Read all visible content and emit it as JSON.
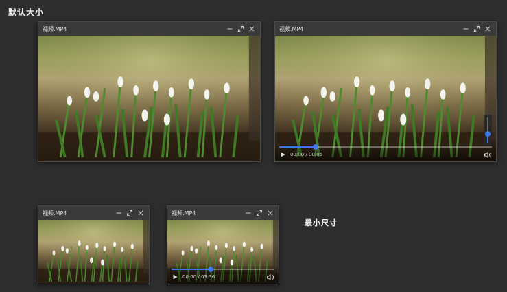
{
  "labels": {
    "default_size": "默认大小",
    "min_size": "最小尺寸"
  },
  "windows": [
    {
      "title": "视频.MP4",
      "show_controls": false
    },
    {
      "title": "视频.MP4",
      "show_controls": true,
      "time": "00:00 / 00:05",
      "progress": 0.17,
      "volume": 0.35
    },
    {
      "title": "视频.MP4",
      "show_controls": false
    },
    {
      "title": "视频.MP4",
      "show_controls": true,
      "time": "00:00 / 03:36",
      "progress": 0.38
    }
  ],
  "icons": {
    "minimize": "minimize-icon",
    "maximize": "maximize-icon",
    "close": "close-icon",
    "play": "play-icon",
    "volume": "volume-icon"
  },
  "colors": {
    "accent": "#3c78e8",
    "background": "#2e2e2e",
    "titlebar": "#3a3a3a"
  }
}
